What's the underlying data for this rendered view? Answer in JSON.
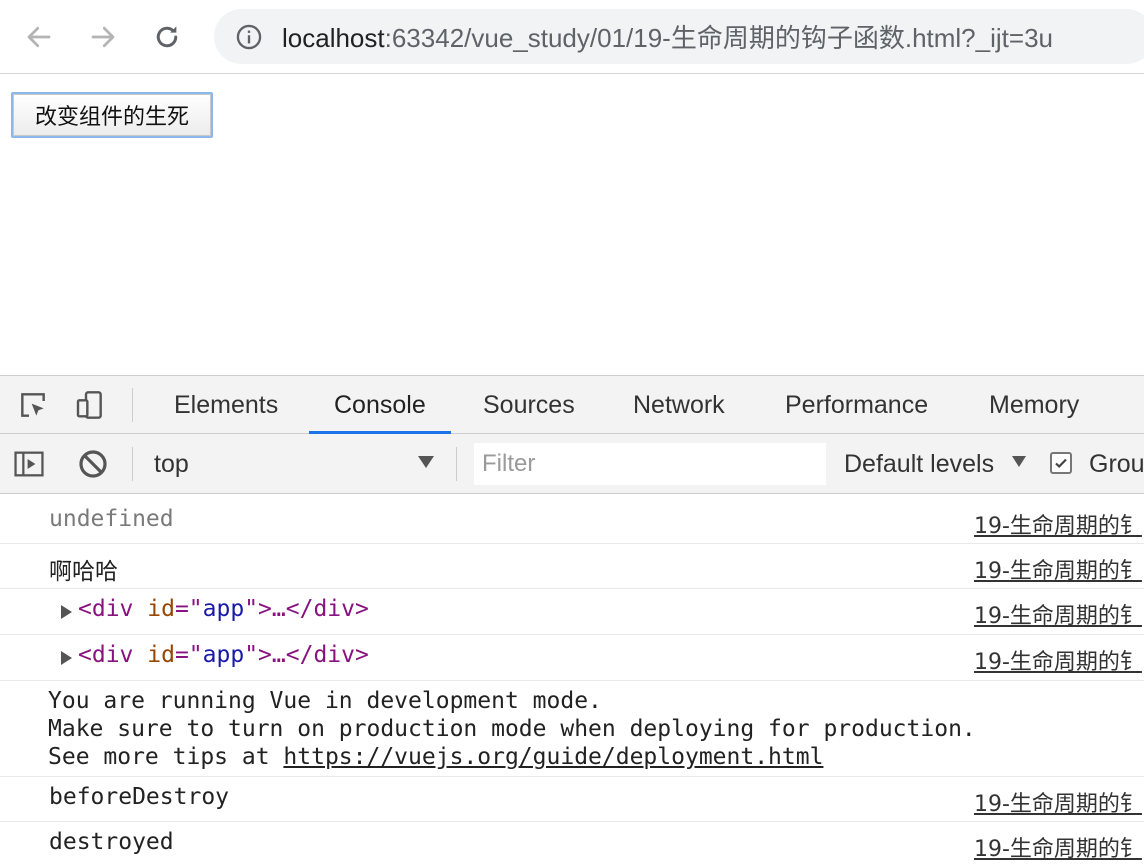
{
  "browser": {
    "url_host": "localhost",
    "url_rest": ":63342/vue_study/01/19-生命周期的钩子函数.html?_ijt=3u"
  },
  "page": {
    "button_label": "改变组件的生死"
  },
  "devtools": {
    "tabs": [
      "Elements",
      "Console",
      "Sources",
      "Network",
      "Performance",
      "Memory"
    ],
    "active_tab": "Console",
    "context": "top",
    "filter_placeholder": "Filter",
    "levels": "Default levels",
    "group_label": "Grou"
  },
  "console": {
    "rows": [
      {
        "text": "undefined",
        "source": "19-生命周期的钅"
      },
      {
        "text": "啊哈哈",
        "source": "19-生命周期的钅"
      },
      {
        "tag_open": "<div",
        "attr": "id",
        "eq": "=\"",
        "val": "app",
        "rest": "\">…</div>",
        "source": "19-生命周期的钅"
      },
      {
        "tag_open": "<div",
        "attr": "id",
        "eq": "=\"",
        "val": "app",
        "rest": "\">…</div>",
        "source": "19-生命周期的钅"
      },
      {
        "line1": "You are running Vue in development mode.",
        "line2": "Make sure to turn on production mode when deploying for production.",
        "line3_prefix": "See more tips at ",
        "line3_link": "https://vuejs.org/guide/deployment.html"
      },
      {
        "text": "beforeDestroy",
        "source": "19-生命周期的钅"
      },
      {
        "text": "destroyed",
        "source": "19-生命周期的钅"
      }
    ]
  },
  "colors": {
    "active_tab_underline": "#1a73e8",
    "tag": "#881280",
    "attr": "#994500",
    "value": "#1a1aa6"
  }
}
